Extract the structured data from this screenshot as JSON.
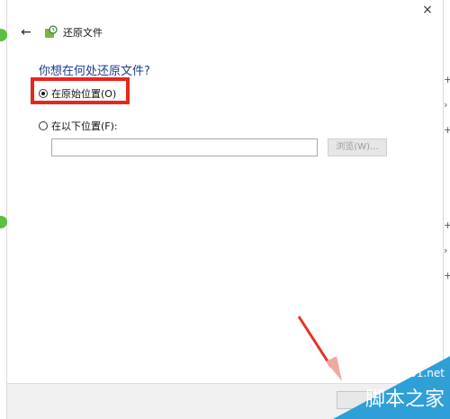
{
  "window": {
    "title": "还原文件",
    "close_label": "×",
    "back_label": "←"
  },
  "main": {
    "question": "你想在何处还原文件?",
    "option_original": "在原始位置(O)",
    "option_other": "在以下位置(F):",
    "path_value": "",
    "browse_label": "浏览(W)..."
  },
  "watermark": {
    "line1": "jb51.net",
    "line2": "脚本之家"
  },
  "edge_glyphs": {
    "plus": "+",
    "chevron": "›"
  },
  "colors": {
    "highlight": "#e8261d",
    "question_text": "#1a3e8f",
    "watermark_bg": "#2f9fd8"
  }
}
